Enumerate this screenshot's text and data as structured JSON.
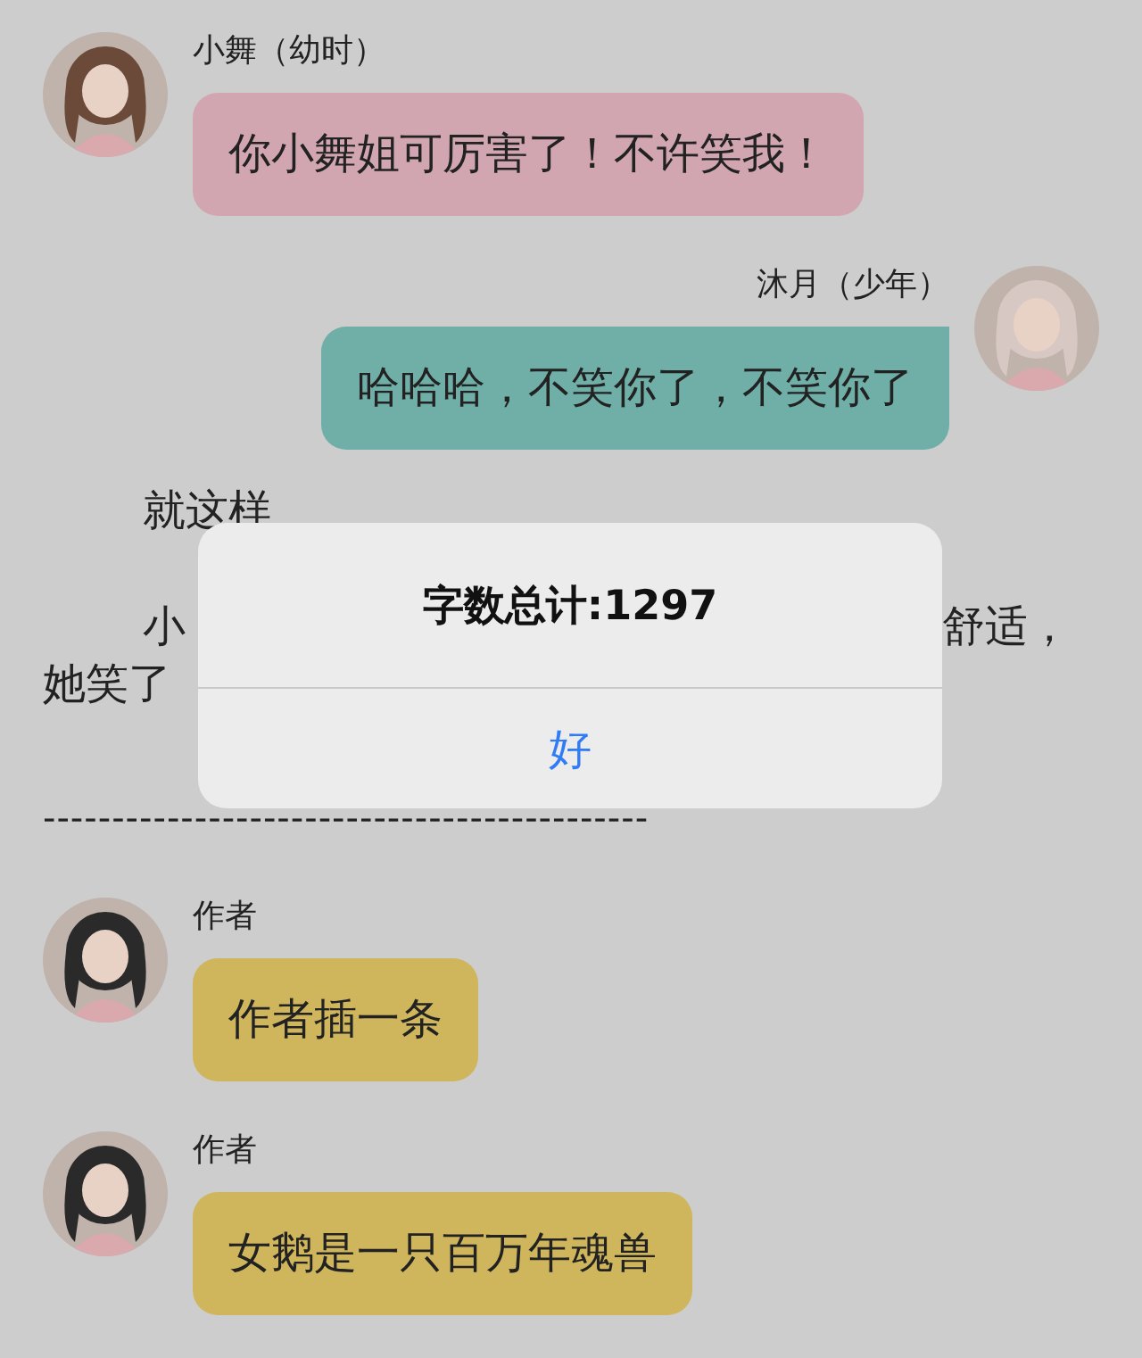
{
  "feed": [
    {
      "kind": "message",
      "outgoing": false,
      "sender": "小舞（幼时）",
      "text": "你小舞姐可厉害了！不许笑我！",
      "color": "#d2a6b1"
    },
    {
      "kind": "message",
      "outgoing": true,
      "sender": "沐月（少年）",
      "text": "哈哈哈，不笑你了，不笑你了",
      "color": "#6fafa8"
    },
    {
      "kind": "paragraph",
      "lines": [
        {
          "indent": true,
          "left": "就这样"
        }
      ]
    },
    {
      "kind": "paragraph",
      "lines": [
        {
          "indent": true,
          "left": "小",
          "right": "舒适，"
        },
        {
          "indent": false,
          "left": "她笑了"
        }
      ]
    },
    {
      "kind": "divider",
      "text": "--------------------------------------------"
    },
    {
      "kind": "message",
      "outgoing": false,
      "sender": "作者",
      "text": "作者插一条",
      "color": "#cfb55c"
    },
    {
      "kind": "message",
      "outgoing": false,
      "sender": "作者",
      "text": "女鹅是一只百万年魂兽",
      "color": "#cfb55c"
    }
  ],
  "dialog": {
    "title": "字数总计:1297",
    "button": "好"
  }
}
